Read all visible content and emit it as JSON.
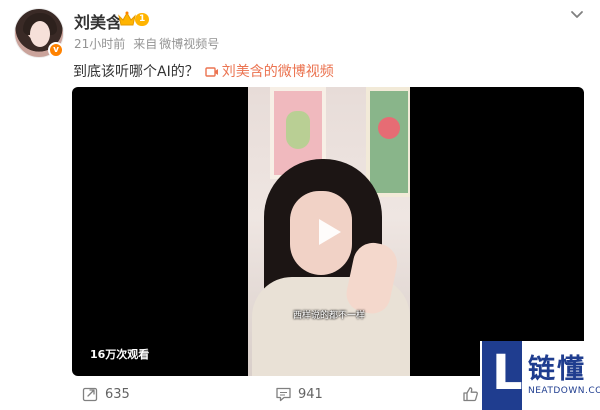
{
  "header": {
    "username": "刘美含",
    "level_badge": "1",
    "time": "21小时前",
    "source_prefix": "来自",
    "source": "微博视频号",
    "verified_mark": "v"
  },
  "post": {
    "text": "到底该听哪个AI的？",
    "video_link": "刘美含的微博视频"
  },
  "video": {
    "views": "16万次观看",
    "subtitle": "西样说的都不一样"
  },
  "actions": {
    "forward_count": "635",
    "comment_count": "941"
  },
  "watermark": {
    "letter": "L",
    "brand": "链懂",
    "domain": "NEATDOWN.COM"
  },
  "colors": {
    "link": "#eb7350",
    "meta": "#939393",
    "watermark": "#1f3d8f",
    "verified": "#ff8200"
  },
  "icons": [
    "crown-icon",
    "chevron-down-icon",
    "video-icon",
    "play-icon",
    "forward-icon",
    "comment-icon",
    "like-icon"
  ]
}
